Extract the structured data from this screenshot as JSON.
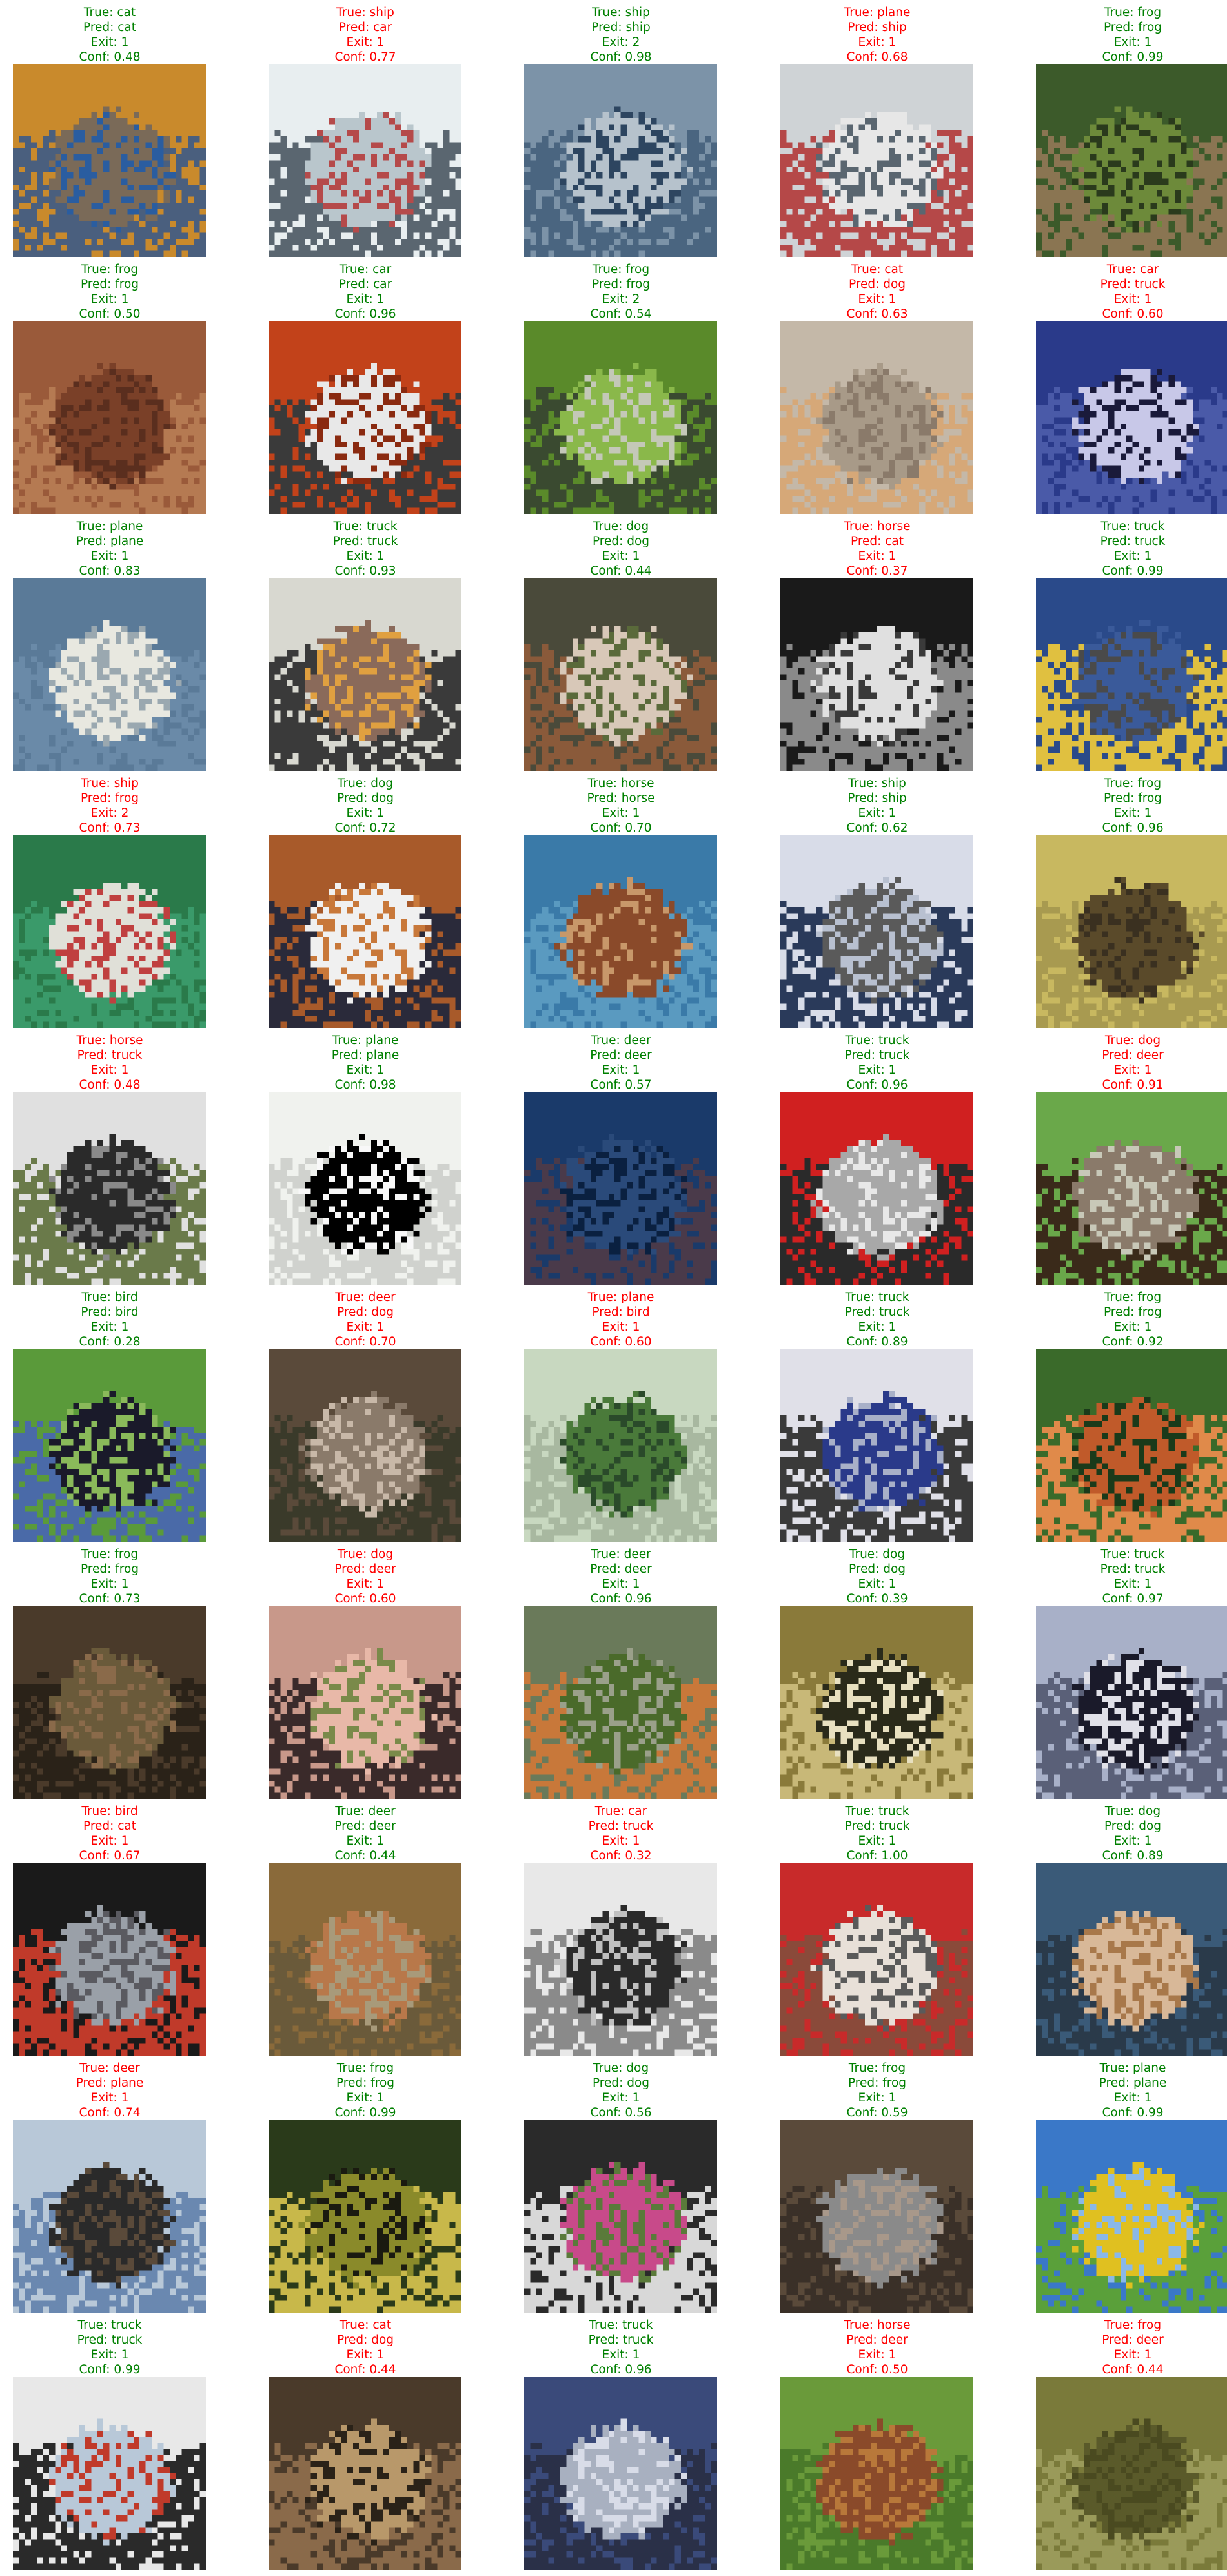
{
  "colors": {
    "correct": "#008000",
    "incorrect": "#ff0000",
    "background": "#ffffff"
  },
  "samples": [
    {
      "true_label": "True: cat",
      "pred_label": "Pred: cat",
      "exit_label": "Exit: 1",
      "conf_label": "Conf: 0.48",
      "correct": true,
      "image": "cat-on-blue-cloth",
      "palette": [
        "#c98a2c",
        "#7a6a58",
        "#4a5f7e",
        "#2a5da0"
      ]
    },
    {
      "true_label": "True: ship",
      "pred_label": "Pred: car",
      "exit_label": "Exit: 1",
      "conf_label": "Conf: 0.77",
      "correct": false,
      "image": "white-boat",
      "palette": [
        "#e8eef0",
        "#b9c6cc",
        "#5a6670",
        "#b54a4a"
      ]
    },
    {
      "true_label": "True: ship",
      "pred_label": "Pred: ship",
      "exit_label": "Exit: 2",
      "conf_label": "Conf: 0.98",
      "correct": true,
      "image": "ship-in-water",
      "palette": [
        "#7c93a8",
        "#b6c2cc",
        "#4a6580",
        "#2d4560"
      ]
    },
    {
      "true_label": "True: plane",
      "pred_label": "Pred: ship",
      "exit_label": "Exit: 1",
      "conf_label": "Conf: 0.68",
      "correct": false,
      "image": "plane-on-sign",
      "palette": [
        "#cfd3d6",
        "#e7e7e7",
        "#b54848",
        "#5a6670"
      ]
    },
    {
      "true_label": "True: frog",
      "pred_label": "Pred: frog",
      "exit_label": "Exit: 1",
      "conf_label": "Conf: 0.99",
      "correct": true,
      "image": "frog-in-grass",
      "palette": [
        "#3c5a2a",
        "#6d8a3a",
        "#8a7552",
        "#2a3a1c"
      ]
    },
    {
      "true_label": "True: frog",
      "pred_label": "Pred: frog",
      "exit_label": "Exit: 1",
      "conf_label": "Conf: 0.50",
      "correct": true,
      "image": "brown-frog",
      "palette": [
        "#9a5a3a",
        "#7a4028",
        "#b57a52",
        "#5a2e1e"
      ]
    },
    {
      "true_label": "True: car",
      "pred_label": "Pred: car",
      "exit_label": "Exit: 1",
      "conf_label": "Conf: 0.96",
      "correct": true,
      "image": "white-car-red-bg",
      "palette": [
        "#c2421a",
        "#e8e8e8",
        "#3a3a3a",
        "#8a2a10"
      ]
    },
    {
      "true_label": "True: frog",
      "pred_label": "Pred: frog",
      "exit_label": "Exit: 2",
      "conf_label": "Conf: 0.54",
      "correct": true,
      "image": "green-frog",
      "palette": [
        "#5a8a2a",
        "#8ab84a",
        "#3a4a30",
        "#c4c8b8"
      ]
    },
    {
      "true_label": "True: cat",
      "pred_label": "Pred: dog",
      "exit_label": "Exit: 1",
      "conf_label": "Conf: 0.63",
      "correct": false,
      "image": "grey-cat",
      "palette": [
        "#c4b8a8",
        "#a89a88",
        "#d6a878",
        "#8a7a6a"
      ]
    },
    {
      "true_label": "True: car",
      "pred_label": "Pred: truck",
      "exit_label": "Exit: 1",
      "conf_label": "Conf: 0.60",
      "correct": false,
      "image": "blue-suv",
      "palette": [
        "#2a3a8a",
        "#c8c8e8",
        "#4a5aa8",
        "#1a1a3a"
      ]
    },
    {
      "true_label": "True: plane",
      "pred_label": "Pred: plane",
      "exit_label": "Exit: 1",
      "conf_label": "Conf: 0.83",
      "correct": true,
      "image": "jet-in-sky",
      "palette": [
        "#5a7a98",
        "#e8e8e0",
        "#6a8aa8",
        "#9aa8b0"
      ]
    },
    {
      "true_label": "True: truck",
      "pred_label": "Pred: truck",
      "exit_label": "Exit: 1",
      "conf_label": "Conf: 0.93",
      "correct": true,
      "image": "delivery-truck",
      "palette": [
        "#d8d8d0",
        "#8a6a5a",
        "#3a3a3a",
        "#e0a040"
      ]
    },
    {
      "true_label": "True: dog",
      "pred_label": "Pred: dog",
      "exit_label": "Exit: 1",
      "conf_label": "Conf: 0.44",
      "correct": true,
      "image": "white-brown-dog",
      "palette": [
        "#4a4a3a",
        "#d8c8b8",
        "#8a5a3a",
        "#5a6a3a"
      ]
    },
    {
      "true_label": "True: horse",
      "pred_label": "Pred: cat",
      "exit_label": "Exit: 1",
      "conf_label": "Conf: 0.37",
      "correct": false,
      "image": "white-horse-dark-bg",
      "palette": [
        "#1a1a1a",
        "#e0e0e0",
        "#8a8a8a",
        "#3a3a3a"
      ]
    },
    {
      "true_label": "True: truck",
      "pred_label": "Pred: truck",
      "exit_label": "Exit: 1",
      "conf_label": "Conf: 0.99",
      "correct": true,
      "image": "blue-truck",
      "palette": [
        "#2a4a8a",
        "#3a5a9a",
        "#e0c040",
        "#4a4a4a"
      ]
    },
    {
      "true_label": "True: ship",
      "pred_label": "Pred: frog",
      "exit_label": "Exit: 2",
      "conf_label": "Conf: 0.73",
      "correct": false,
      "image": "boat-green-water",
      "palette": [
        "#2a7a4a",
        "#e0e0d8",
        "#3a9a6a",
        "#c04040"
      ]
    },
    {
      "true_label": "True: dog",
      "pred_label": "Pred: dog",
      "exit_label": "Exit: 1",
      "conf_label": "Conf: 0.72",
      "correct": true,
      "image": "beagle-puppy",
      "palette": [
        "#a85a2a",
        "#f0f0f0",
        "#2a2a3a",
        "#c8783a"
      ]
    },
    {
      "true_label": "True: horse",
      "pred_label": "Pred: horse",
      "exit_label": "Exit: 1",
      "conf_label": "Conf: 0.70",
      "correct": true,
      "image": "horse-head",
      "palette": [
        "#3a7aa8",
        "#8a4a2a",
        "#5a9ac0",
        "#c8986a"
      ]
    },
    {
      "true_label": "True: ship",
      "pred_label": "Pred: ship",
      "exit_label": "Exit: 1",
      "conf_label": "Conf: 0.62",
      "correct": true,
      "image": "ship-on-sea",
      "palette": [
        "#d8dce8",
        "#5a5a5a",
        "#2a3a5a",
        "#b8c0d0"
      ]
    },
    {
      "true_label": "True: frog",
      "pred_label": "Pred: frog",
      "exit_label": "Exit: 1",
      "conf_label": "Conf: 0.96",
      "correct": true,
      "image": "yellow-frog",
      "palette": [
        "#c8b860",
        "#5a4a2a",
        "#a89a50",
        "#3a3020"
      ]
    },
    {
      "true_label": "True: horse",
      "pred_label": "Pred: truck",
      "exit_label": "Exit: 1",
      "conf_label": "Conf: 0.48",
      "correct": false,
      "image": "dark-horse-trailer",
      "palette": [
        "#e0e0e0",
        "#2a2a2a",
        "#6a7a4a",
        "#8a8a8a"
      ]
    },
    {
      "true_label": "True: plane",
      "pred_label": "Pred: plane",
      "exit_label": "Exit: 1",
      "conf_label": "Conf: 0.98",
      "correct": true,
      "image": "black-plane-white-bg",
      "palette": [
        "#f0f2ee",
        "#000000",
        "#d0d2ce",
        "#f8f8f8"
      ]
    },
    {
      "true_label": "True: deer",
      "pred_label": "Pred: deer",
      "exit_label": "Exit: 1",
      "conf_label": "Conf: 0.57",
      "correct": true,
      "image": "deer-blue-night",
      "palette": [
        "#1a3a6a",
        "#2a4a7a",
        "#4a3a4a",
        "#0a2040"
      ]
    },
    {
      "true_label": "True: truck",
      "pred_label": "Pred: truck",
      "exit_label": "Exit: 1",
      "conf_label": "Conf: 0.96",
      "correct": true,
      "image": "red-fire-truck",
      "palette": [
        "#d02020",
        "#a8a8a8",
        "#2a2a2a",
        "#e8e8e8"
      ]
    },
    {
      "true_label": "True: dog",
      "pred_label": "Pred: deer",
      "exit_label": "Exit: 1",
      "conf_label": "Conf: 0.91",
      "correct": false,
      "image": "dog-on-grass",
      "palette": [
        "#6aa84a",
        "#8a7a6a",
        "#3a2a1a",
        "#c8c8b8"
      ]
    },
    {
      "true_label": "True: bird",
      "pred_label": "Pred: bird",
      "exit_label": "Exit: 1",
      "conf_label": "Conf: 0.28",
      "correct": true,
      "image": "black-bird-grass",
      "palette": [
        "#5a9a3a",
        "#1a1a2a",
        "#4a6aa8",
        "#8aba5a"
      ]
    },
    {
      "true_label": "True: deer",
      "pred_label": "Pred: dog",
      "exit_label": "Exit: 1",
      "conf_label": "Conf: 0.70",
      "correct": false,
      "image": "blurry-deer",
      "palette": [
        "#5a4a3a",
        "#8a7a6a",
        "#3a3a2a",
        "#c8b8a8"
      ]
    },
    {
      "true_label": "True: plane",
      "pred_label": "Pred: bird",
      "exit_label": "Exit: 1",
      "conf_label": "Conf: 0.60",
      "correct": false,
      "image": "green-plane",
      "palette": [
        "#c8d8c0",
        "#4a7a3a",
        "#a8b8a0",
        "#2a4a2a"
      ]
    },
    {
      "true_label": "True: truck",
      "pred_label": "Pred: truck",
      "exit_label": "Exit: 1",
      "conf_label": "Conf: 0.89",
      "correct": true,
      "image": "blue-white-truck",
      "palette": [
        "#e0e0e8",
        "#2a3a8a",
        "#3a3a3a",
        "#a8b0c8"
      ]
    },
    {
      "true_label": "True: frog",
      "pred_label": "Pred: frog",
      "exit_label": "Exit: 1",
      "conf_label": "Conf: 0.92",
      "correct": true,
      "image": "orange-frog",
      "palette": [
        "#3a6a2a",
        "#c05a2a",
        "#e08a4a",
        "#1a3a1a"
      ]
    },
    {
      "true_label": "True: frog",
      "pred_label": "Pred: frog",
      "exit_label": "Exit: 1",
      "conf_label": "Conf: 0.73",
      "correct": true,
      "image": "dark-frog",
      "palette": [
        "#4a3a2a",
        "#6a5a3a",
        "#2a2218",
        "#8a6a4a"
      ]
    },
    {
      "true_label": "True: dog",
      "pred_label": "Pred: deer",
      "exit_label": "Exit: 1",
      "conf_label": "Conf: 0.60",
      "correct": false,
      "image": "dog-closeup",
      "palette": [
        "#c8988a",
        "#e8b8a8",
        "#3a2a2a",
        "#7a8a4a"
      ]
    },
    {
      "true_label": "True: deer",
      "pred_label": "Pred: deer",
      "exit_label": "Exit: 1",
      "conf_label": "Conf: 0.96",
      "correct": true,
      "image": "deer-in-field",
      "palette": [
        "#6a7a5a",
        "#4a6a2a",
        "#c8783a",
        "#9aa08a"
      ]
    },
    {
      "true_label": "True: dog",
      "pred_label": "Pred: dog",
      "exit_label": "Exit: 1",
      "conf_label": "Conf: 0.39",
      "correct": true,
      "image": "dark-dog-face",
      "palette": [
        "#8a7a3a",
        "#2a2a1a",
        "#c8b878",
        "#e8e0c0"
      ]
    },
    {
      "true_label": "True: truck",
      "pred_label": "Pred: truck",
      "exit_label": "Exit: 1",
      "conf_label": "Conf: 0.97",
      "correct": true,
      "image": "semi-truck",
      "palette": [
        "#a8b0c8",
        "#1a1a2a",
        "#5a6078",
        "#e0e0e8"
      ]
    },
    {
      "true_label": "True: bird",
      "pred_label": "Pred: cat",
      "exit_label": "Exit: 1",
      "conf_label": "Conf: 0.67",
      "correct": false,
      "image": "ostrich-face",
      "palette": [
        "#1a1a1a",
        "#9aa0a8",
        "#c03a2a",
        "#5a5a60"
      ]
    },
    {
      "true_label": "True: deer",
      "pred_label": "Pred: deer",
      "exit_label": "Exit: 1",
      "conf_label": "Conf: 0.44",
      "correct": true,
      "image": "brown-deer",
      "palette": [
        "#8a6a3a",
        "#b8784a",
        "#6a5a3a",
        "#a89a7a"
      ]
    },
    {
      "true_label": "True: car",
      "pred_label": "Pred: truck",
      "exit_label": "Exit: 1",
      "conf_label": "Conf: 0.32",
      "correct": false,
      "image": "old-car-bw",
      "palette": [
        "#e8e8e8",
        "#2a2a2a",
        "#8a8a8a",
        "#c0c0c0"
      ]
    },
    {
      "true_label": "True: truck",
      "pred_label": "Pred: truck",
      "exit_label": "Exit: 1",
      "conf_label": "Conf: 1.00",
      "correct": true,
      "image": "fire-truck-red",
      "palette": [
        "#c82a2a",
        "#e8e0d8",
        "#8a4a3a",
        "#5a5a5a"
      ]
    },
    {
      "true_label": "True: dog",
      "pred_label": "Pred: dog",
      "exit_label": "Exit: 1",
      "conf_label": "Conf: 0.89",
      "correct": true,
      "image": "fluffy-dog",
      "palette": [
        "#3a5a78",
        "#d8b898",
        "#2a3a4a",
        "#a8784a"
      ]
    },
    {
      "true_label": "True: deer",
      "pred_label": "Pred: plane",
      "exit_label": "Exit: 1",
      "conf_label": "Conf: 0.74",
      "correct": false,
      "image": "deer-antlers-sky",
      "palette": [
        "#b8c8d8",
        "#2a2a2a",
        "#6a88b0",
        "#5a4a3a"
      ]
    },
    {
      "true_label": "True: frog",
      "pred_label": "Pred: frog",
      "exit_label": "Exit: 1",
      "conf_label": "Conf: 0.99",
      "correct": true,
      "image": "spotted-frog",
      "palette": [
        "#2a3a1a",
        "#8a8a2a",
        "#c8b84a",
        "#1a1a10"
      ]
    },
    {
      "true_label": "True: dog",
      "pred_label": "Pred: dog",
      "exit_label": "Exit: 1",
      "conf_label": "Conf: 0.56",
      "correct": true,
      "image": "black-white-dog",
      "palette": [
        "#2a2a2a",
        "#c84a8a",
        "#d8d8d8",
        "#5a7a3a"
      ]
    },
    {
      "true_label": "True: frog",
      "pred_label": "Pred: frog",
      "exit_label": "Exit: 1",
      "conf_label": "Conf: 0.59",
      "correct": true,
      "image": "grey-frog",
      "palette": [
        "#5a4a3a",
        "#8a8a8a",
        "#3a3028",
        "#a8988a"
      ]
    },
    {
      "true_label": "True: plane",
      "pred_label": "Pred: plane",
      "exit_label": "Exit: 1",
      "conf_label": "Conf: 0.99",
      "correct": true,
      "image": "yellow-biplane",
      "palette": [
        "#3a78c8",
        "#e0c020",
        "#5aa03a",
        "#8ab8e8"
      ]
    },
    {
      "true_label": "True: truck",
      "pred_label": "Pred: truck",
      "exit_label": "Exit: 1",
      "conf_label": "Conf: 0.99",
      "correct": true,
      "image": "white-truck",
      "palette": [
        "#e8e8e8",
        "#b8c8d8",
        "#2a2a2a",
        "#c03a2a"
      ]
    },
    {
      "true_label": "True: cat",
      "pred_label": "Pred: dog",
      "exit_label": "Exit: 1",
      "conf_label": "Conf: 0.44",
      "correct": false,
      "image": "tabby-cat",
      "palette": [
        "#4a3a2a",
        "#b8986a",
        "#8a6a4a",
        "#2a2218"
      ]
    },
    {
      "true_label": "True: truck",
      "pred_label": "Pred: truck",
      "exit_label": "Exit: 1",
      "conf_label": "Conf: 0.96",
      "correct": true,
      "image": "silver-truck",
      "palette": [
        "#3a4a7a",
        "#a8b0c0",
        "#2a3048",
        "#d8dce8"
      ]
    },
    {
      "true_label": "True: horse",
      "pred_label": "Pred: deer",
      "exit_label": "Exit: 1",
      "conf_label": "Conf: 0.50",
      "correct": false,
      "image": "brown-horse-field",
      "palette": [
        "#6a9a3a",
        "#8a4a2a",
        "#4a7a2a",
        "#b8783a"
      ]
    },
    {
      "true_label": "True: frog",
      "pred_label": "Pred: deer",
      "exit_label": "Exit: 1",
      "conf_label": "Conf: 0.44",
      "correct": false,
      "image": "camouflaged-frog",
      "palette": [
        "#7a7a3a",
        "#5a5a2a",
        "#9a9a5a",
        "#4a4a20"
      ]
    }
  ]
}
